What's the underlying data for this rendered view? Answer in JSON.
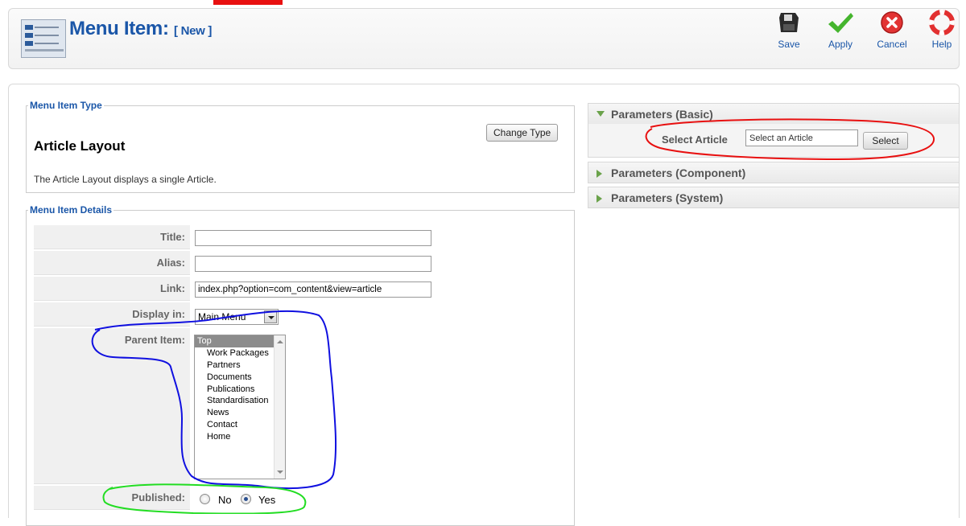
{
  "header": {
    "title": "Menu Item:",
    "subtitle": "[ New ]",
    "toolbar": [
      {
        "label": "Save",
        "icon": "floppy-disk-icon"
      },
      {
        "label": "Apply",
        "icon": "checkmark-icon"
      },
      {
        "label": "Cancel",
        "icon": "cancel-icon"
      },
      {
        "label": "Help",
        "icon": "lifebuoy-icon"
      }
    ]
  },
  "menu_item_type": {
    "legend": "Menu Item Type",
    "name": "Article Layout",
    "description": "The Article Layout displays a single Article.",
    "change_button": "Change Type"
  },
  "details": {
    "legend": "Menu Item Details",
    "title_label": "Title:",
    "title_value": "",
    "alias_label": "Alias:",
    "alias_value": "",
    "link_label": "Link:",
    "link_value": "index.php?option=com_content&view=article",
    "display_label": "Display in:",
    "display_value": "Main Menu",
    "parent_label": "Parent Item:",
    "parent_options": [
      "Top",
      "Work Packages",
      "Partners",
      "Documents",
      "Publications",
      "Standardisation",
      "News",
      "Contact",
      "Home"
    ],
    "parent_selected": "Top",
    "published_label": "Published:",
    "published_no": "No",
    "published_yes": "Yes",
    "published_value": "Yes"
  },
  "parameters": {
    "basic_title": "Parameters (Basic)",
    "component_title": "Parameters (Component)",
    "system_title": "Parameters (System)",
    "select_article_label": "Select Article",
    "select_article_placeholder": "Select an Article",
    "select_button": "Select"
  },
  "colors": {
    "accent": "#1a56a8",
    "annotation_red": "#e81010",
    "annotation_blue": "#1010e0",
    "annotation_green": "#22dd22"
  }
}
